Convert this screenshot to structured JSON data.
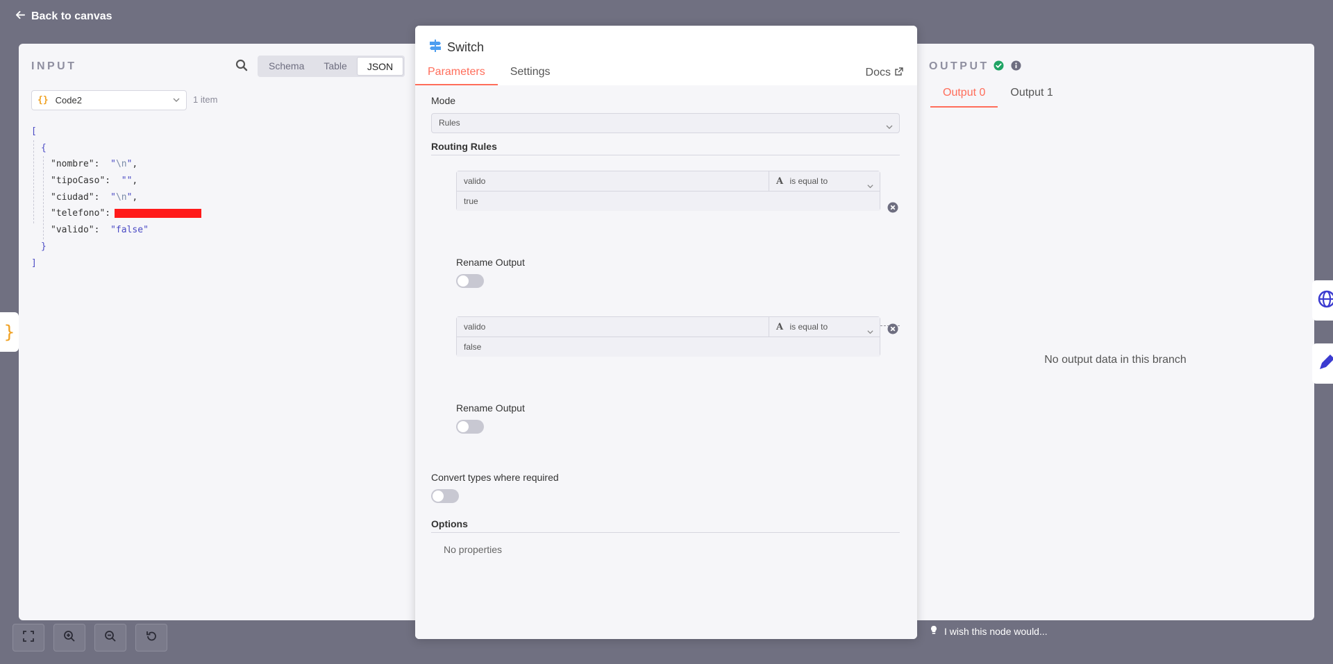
{
  "nav": {
    "back_label": "Back to canvas"
  },
  "input_panel": {
    "title": "INPUT",
    "views": [
      "Schema",
      "Table",
      "JSON"
    ],
    "active_view": "JSON",
    "node_select": {
      "icon": "{}",
      "value": "Code2"
    },
    "item_count": "1 item",
    "json": {
      "open_bracket": "[",
      "open_brace": "{",
      "fields": [
        {
          "key": "\"nombre\":",
          "value_open": "\"",
          "escape": "\\n",
          "value_close": "\"",
          "comma": ","
        },
        {
          "key": "\"tipoCaso\":",
          "value": "\"\"",
          "comma": ","
        },
        {
          "key": "\"ciudad\":",
          "value_open": "\"",
          "escape": "\\n",
          "value_close": "\"",
          "comma": ","
        },
        {
          "key": "\"telefono\":"
        },
        {
          "key": "\"valido\":",
          "value": "\"false\""
        }
      ],
      "close_brace": "}",
      "close_bracket": "]"
    }
  },
  "modal": {
    "node_title": "Switch",
    "tabs": [
      "Parameters",
      "Settings"
    ],
    "active_tab": "Parameters",
    "docs_label": "Docs",
    "mode": {
      "label": "Mode",
      "value": "Rules"
    },
    "routing_rules": {
      "title": "Routing Rules",
      "rules": [
        {
          "left": "valido",
          "operator": "is equal to",
          "right": "true",
          "rename_label": "Rename Output"
        },
        {
          "left": "valido",
          "operator": "is equal to",
          "right": "false",
          "rename_label": "Rename Output"
        }
      ]
    },
    "convert_types_label": "Convert types where required",
    "options": {
      "title": "Options",
      "empty": "No properties"
    }
  },
  "output_panel": {
    "title": "OUTPUT",
    "tabs": [
      "Output 0",
      "Output 1"
    ],
    "active_tab": "Output 0",
    "empty_message": "No output data in this branch"
  },
  "footer": {
    "wish_label": "I wish this node would..."
  },
  "colors": {
    "accent": "#ff6d5a",
    "success": "#20a464",
    "string_value": "#4a4ac4",
    "code_icon": "#f0a224",
    "background": "#707081"
  }
}
